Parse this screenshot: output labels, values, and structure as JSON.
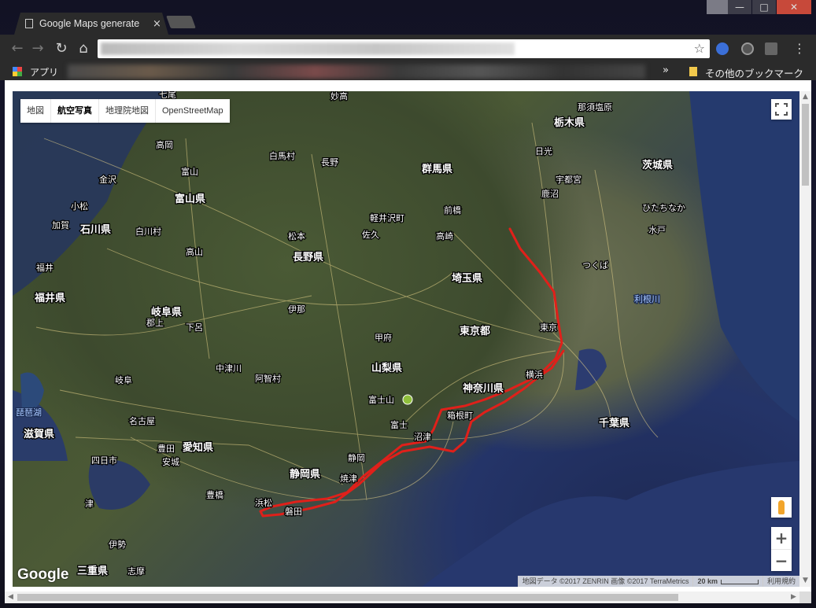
{
  "browser": {
    "tab_title": "Google Maps generate",
    "tab_close": "×",
    "bookmarks": {
      "apps_label": "アプリ",
      "more": "»",
      "other_label": "その他のブックマーク"
    },
    "window_controls": {
      "minimize": "—",
      "maximize": "□",
      "close": "✕"
    }
  },
  "map": {
    "type_controls": [
      "地図",
      "航空写真",
      "地理院地図",
      "OpenStreetMap"
    ],
    "selected_type": "航空写真",
    "google_logo": "Google",
    "attribution": "地図データ ©2017 ZENRIN 画像 ©2017 TerraMetrics",
    "scale": "20 km",
    "terms": "利用規約",
    "zoom_in": "+",
    "zoom_out": "−",
    "route_color": "#e0201a",
    "prefectures": [
      "栃木県",
      "茨城県",
      "群馬県",
      "富山県",
      "石川県",
      "長野県",
      "埼玉県",
      "福井県",
      "岐阜県",
      "東京都",
      "山梨県",
      "神奈川県",
      "千葉県",
      "愛知県",
      "静岡県",
      "滋賀県",
      "三重県"
    ],
    "cities": [
      "那須塩原",
      "日光",
      "宇都宮",
      "鹿沼",
      "ひたちなか",
      "水戸",
      "前橋",
      "高崎",
      "軽井沢町",
      "佐久",
      "白馬村",
      "長野",
      "松本",
      "高山",
      "富山",
      "高岡",
      "金沢",
      "小松",
      "加賀",
      "白川村",
      "福井",
      "郡上",
      "下呂",
      "伊那",
      "甲府",
      "中津川",
      "阿智村",
      "岐阜",
      "名古屋",
      "豊田",
      "安城",
      "四日市",
      "豊橋",
      "浜松",
      "磐田",
      "焼津",
      "静岡",
      "富士",
      "沼津",
      "箱根町",
      "横浜",
      "東京",
      "つくば",
      "富士山",
      "伊勢",
      "志摩",
      "津",
      "妙高",
      "七尾"
    ],
    "water": [
      "琵琶湖",
      "利根川"
    ]
  }
}
